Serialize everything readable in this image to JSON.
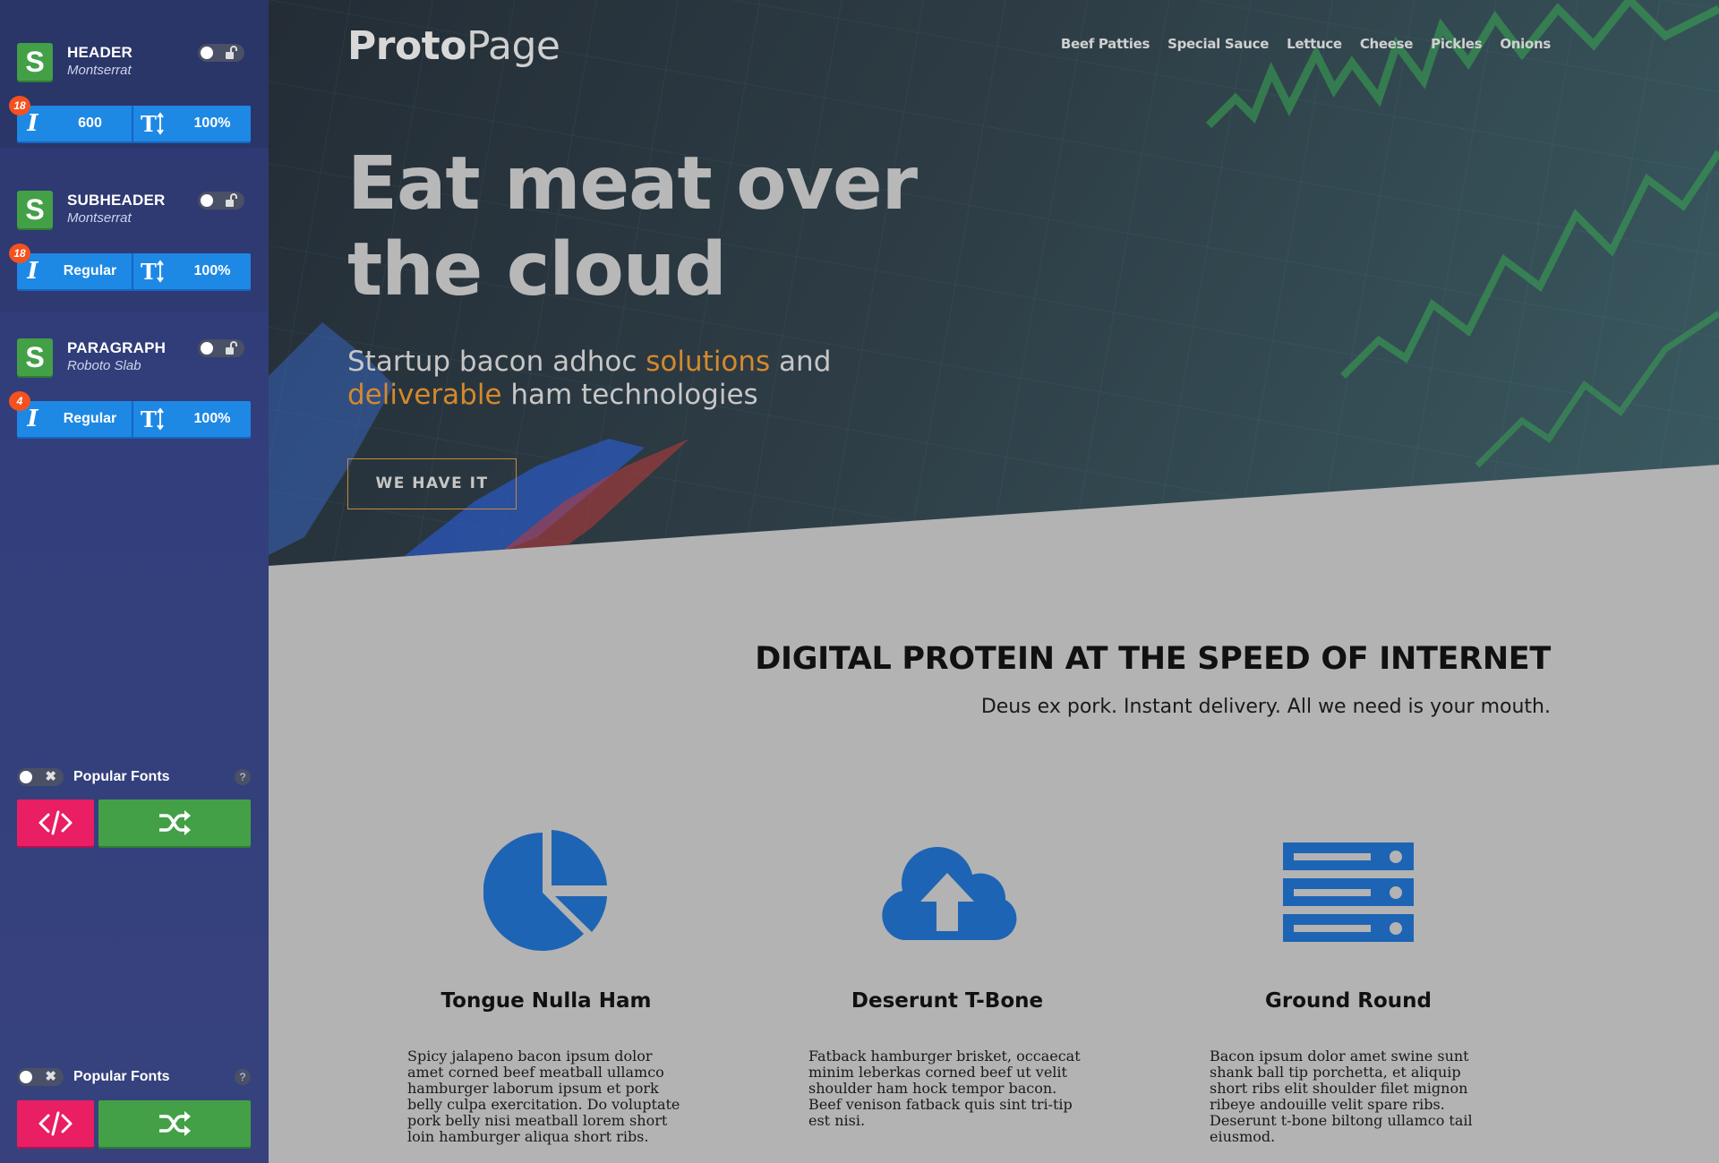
{
  "sidebar": {
    "close_label": "×",
    "font_blocks": [
      {
        "role": "HEADER",
        "font": "Montserrat",
        "badge": "18",
        "weight": "600",
        "size": "100%",
        "logo_letter": "S"
      },
      {
        "role": "SUBHEADER",
        "font": "Montserrat",
        "badge": "18",
        "weight": "Regular",
        "size": "100%",
        "logo_letter": "S"
      },
      {
        "role": "PARAGRAPH",
        "font": "Roboto Slab",
        "badge": "4",
        "weight": "Regular",
        "size": "100%",
        "logo_letter": "S"
      }
    ],
    "popular": [
      {
        "label": "Popular Fonts",
        "help": "?"
      },
      {
        "label": "Popular Fonts",
        "help": "?"
      }
    ]
  },
  "page": {
    "brand_bold": "Proto",
    "brand_light": "Page",
    "nav": [
      "Beef Patties",
      "Special Sauce",
      "Lettuce",
      "Cheese",
      "Pickles",
      "Onions"
    ],
    "hero": {
      "title": "Eat meat over the cloud",
      "sub_1": "Startup bacon adhoc ",
      "sub_hl_1": "solutions",
      "sub_2": " and ",
      "sub_hl_2": "deliverable",
      "sub_3": " ham technologies",
      "cta": "WE HAVE IT"
    },
    "section": {
      "title": "DIGITAL PROTEIN AT THE SPEED OF INTERNET",
      "subtitle": "Deus ex pork. Instant delivery. All we need is your mouth."
    },
    "features": [
      {
        "icon": "pie-chart-icon",
        "title": "Tongue Nulla Ham",
        "text": "Spicy jalapeno bacon ipsum dolor amet corned beef meatball ullamco hamburger laborum ipsum et pork belly culpa exercitation. Do voluptate pork belly nisi meatball lorem short loin hamburger aliqua short ribs."
      },
      {
        "icon": "cloud-upload-icon",
        "title": "Deserunt T-Bone",
        "text": "Fatback hamburger brisket, occaecat minim leberkas corned beef ut velit shoulder ham hock tempor bacon. Beef venison fatback quis sint tri-tip est nisi."
      },
      {
        "icon": "server-icon",
        "title": "Ground Round",
        "text": "Bacon ipsum dolor amet swine sunt shank ball tip porchetta, et aliquip short ribs elit shoulder filet mignon ribeye andouille velit spare ribs. Deserunt t-bone biltong ullamco tail eiusmod."
      }
    ],
    "colors": {
      "accent": "#d4892c",
      "icon_blue": "#1e64b4",
      "sidebar_bg": "#323f7c",
      "control_blue": "#1e88e5",
      "green": "#43a047",
      "pink": "#e91e63"
    }
  }
}
